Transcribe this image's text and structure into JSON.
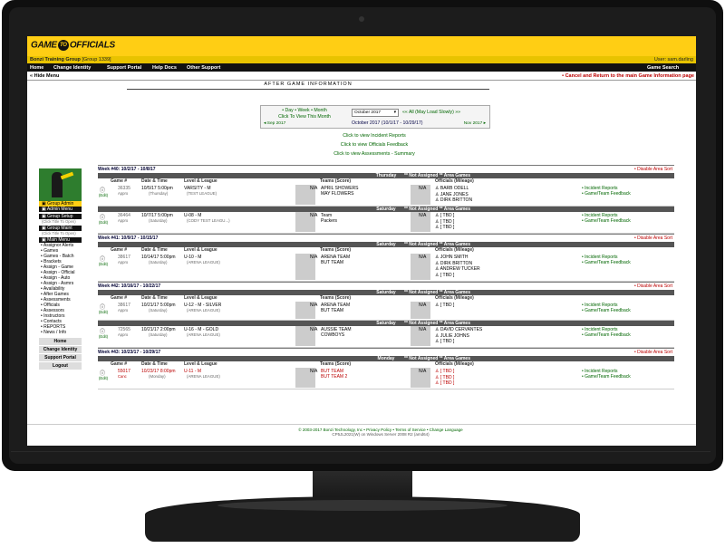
{
  "app": {
    "org": "Bonzi Training Group",
    "group_code": "[Group 1339]",
    "user": "User: sam.darling",
    "nav": [
      "Home",
      "Change Identity",
      "Support Portal",
      "Help Docs",
      "Other Support"
    ],
    "game_search": "Game Search",
    "hide_menu": "Hide Menu",
    "cancel_return": "Cancel and Return to the main Game Information page",
    "page_title": "AFTER GAME INFORMATION",
    "logo": "GAME OFFICIALS"
  },
  "period": {
    "day": "Day",
    "week": "Week",
    "month": "Month",
    "view_month": "Click To View This Month",
    "select_value": "October 2017",
    "all": "All (May Load Slowly)",
    "prev": "Sep 2017",
    "range": "October 2017 (10/1/17 - 10/29/17)",
    "next": "Nov 2017"
  },
  "links": [
    "Click to view Incident Reports",
    "Click to view Officials Feedback",
    "Click to view Assessments - Summary"
  ],
  "sidebar": {
    "group_admin": "Group Admin",
    "admin_menu": "Admin Menu",
    "group_setup": "Group Setup",
    "group_setup_sub": "(Click Title To Open)",
    "group_maint": "Group Maint",
    "group_maint_sub": "(Click Title To Open)",
    "main_menu": "Main Menu",
    "items": [
      "Assignor Alerts",
      "Games",
      "Games - Batch",
      "Brackets",
      "Assign - Game",
      "Assign - Official",
      "Assign - Auto",
      "Assign - Asmrs",
      "Availability",
      "After Games",
      "Assessments",
      "Officials",
      "Assessors",
      "Instructors",
      "Contacts",
      "REPORTS",
      "News / Info"
    ],
    "footer": [
      "Home",
      "Change Identity",
      "Support Portal",
      "Logout"
    ]
  },
  "table": {
    "col_headers": {
      "game": "Game #",
      "date": "Date & Time",
      "level": "Level & League",
      "teams": "Teams (Score)",
      "officials": "Officials (Mileage)"
    },
    "not_assigned": "** Not Assigned ** Area Games",
    "disable_sort": "Disable Area Sort",
    "incident": "Incident Reports",
    "feedback": "Game/Team Feedback",
    "edit": "(Edit)",
    "na": "N/A",
    "weeks": [
      {
        "label": "Week #40:   10/2/17 - 10/8/17",
        "days": [
          {
            "day": "Thursday",
            "games": [
              {
                "num": "36335",
                "status": "Appro",
                "date": "10/5/17  5:00pm",
                "dow": "(Thursday)",
                "level": "VARSITY - M",
                "league": "(TEST LEAGUE)",
                "teams": [
                  "APRIL SHOWERS",
                  "MAY FLOWERS"
                ],
                "officials": [
                  "BARB ODELL",
                  "JANE JONES",
                  "DIRK BRITTON"
                ]
              }
            ]
          },
          {
            "day": "Saturday",
            "games": [
              {
                "num": "36464",
                "status": "Appro",
                "date": "10/7/17  5:00pm",
                "dow": "(Saturday)",
                "level": "U-08 - M",
                "league": "(CODY TEST LEAGU...)",
                "teams": [
                  "Team",
                  "Packers"
                ],
                "officials": [
                  "[ TBD ]",
                  "[ TBD ]",
                  "[ TBD ]"
                ]
              }
            ]
          }
        ]
      },
      {
        "label": "Week #41:   10/9/17 - 10/15/17",
        "days": [
          {
            "day": "Saturday",
            "games": [
              {
                "num": "38617",
                "status": "Appro",
                "date": "10/14/17  5:00pm",
                "dow": "(Saturday)",
                "level": "U-10 - M",
                "league": "(ARENA LEAGUE)",
                "teams": [
                  "ARENA TEAM",
                  "BUT TEAM"
                ],
                "officials": [
                  "JOHN SMITH",
                  "DIRK BRITTON",
                  "ANDREW TUCKER",
                  "[ TBD ]"
                ]
              }
            ]
          }
        ]
      },
      {
        "label": "Week #42:   10/16/17 - 10/22/17",
        "days": [
          {
            "day": "Saturday",
            "games": [
              {
                "num": "38617",
                "status": "Appro",
                "date": "10/21/17  5:00pm",
                "dow": "(Saturday)",
                "level": "U-12 - M - SILVER",
                "league": "(ARENA LEAGUE)",
                "teams": [
                  "ARENA TEAM",
                  "BUT TEAM"
                ],
                "officials": [
                  "[ TBD ]"
                ]
              }
            ]
          },
          {
            "day": "Saturday",
            "games": [
              {
                "num": "72565",
                "status": "Appro",
                "date": "10/21/17  2:00pm",
                "dow": "(Saturday)",
                "level": "U-16 - M - GOLD",
                "league": "(ARENA LEAGUE)",
                "teams": [
                  "AUSSIE TEAM",
                  "COWBOYS"
                ],
                "officials": [
                  "DAVID CERVANTES",
                  "JULIE JOHNS",
                  "[ TBD ]"
                ]
              }
            ]
          }
        ]
      },
      {
        "label": "Week #43:   10/23/17 - 10/29/17",
        "days": [
          {
            "day": "Monday",
            "games": [
              {
                "num": "55017",
                "status": "Canc",
                "date": "10/23/17  8:00pm",
                "dow": "(Monday)",
                "level": "U-11 - M",
                "league": "(ARENA LEAGUE)",
                "teams": [
                  "BUT TEAM",
                  "BUT TEAM 2"
                ],
                "officials": [
                  "[ TBD ]",
                  "[ TBD ]",
                  "[ TBD ]"
                ]
              }
            ]
          }
        ]
      }
    ]
  },
  "footer": {
    "line1": "© 2003-2017 Bonzi Technology, Inc    •  Privacy Policy   •  Terms of Service   •  Change Language",
    "line2": "CP5JL2021(W) on Windows Server 2008 R2 (amd64)"
  }
}
